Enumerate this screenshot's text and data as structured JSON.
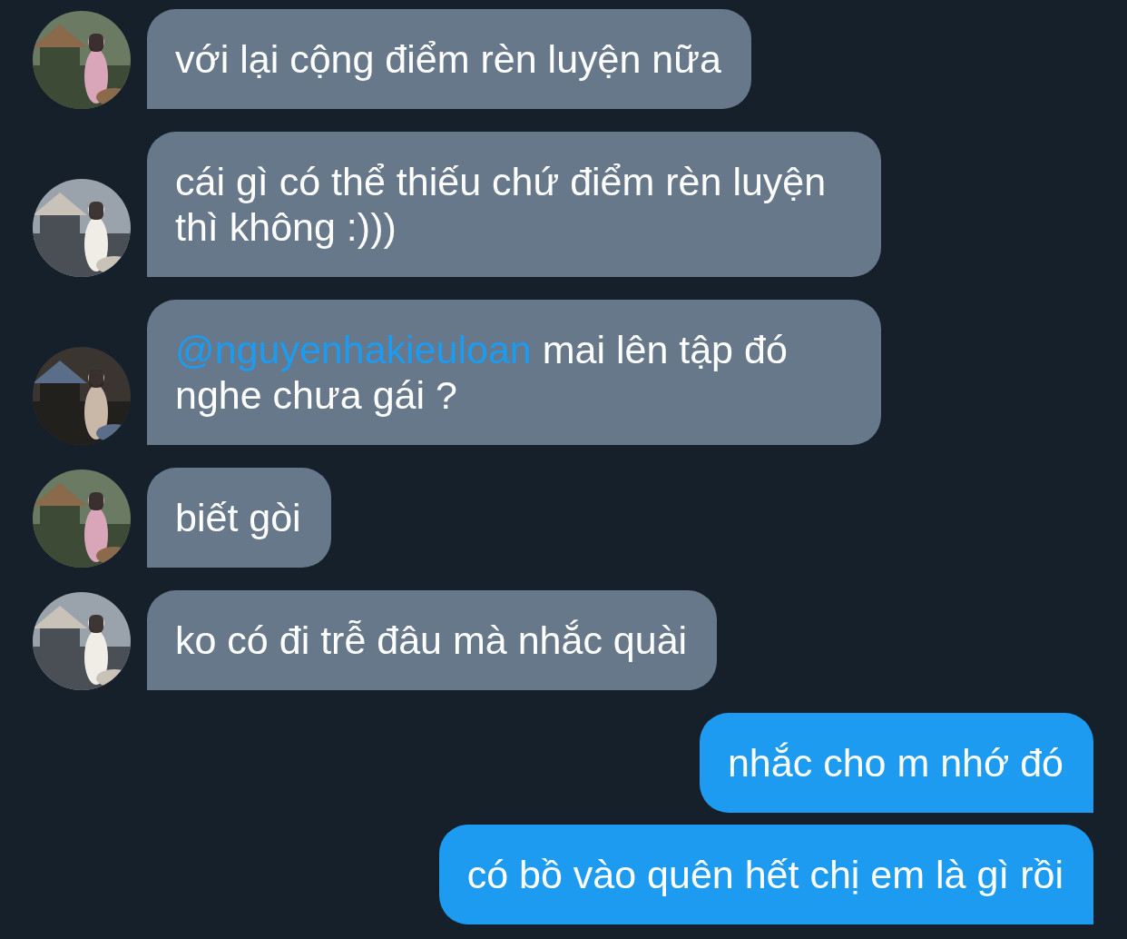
{
  "messages": [
    {
      "kind": "received",
      "text": "với lại cộng điểm rèn luyện nữa"
    },
    {
      "kind": "received",
      "text": "cái gì có thể thiếu chứ điểm rèn luyện thì không :)))"
    },
    {
      "kind": "received",
      "mention": "@nguyenhakieuloan",
      "text": " mai lên tập đó nghe chưa gái ?"
    },
    {
      "kind": "received",
      "text": "biết gòi"
    },
    {
      "kind": "received",
      "text": "ko có đi trễ đâu mà nhắc quài"
    },
    {
      "kind": "sent",
      "text": "nhắc cho m nhớ đó"
    },
    {
      "kind": "sent",
      "text": "có bồ vào quên hết chị em là gì rồi"
    }
  ]
}
